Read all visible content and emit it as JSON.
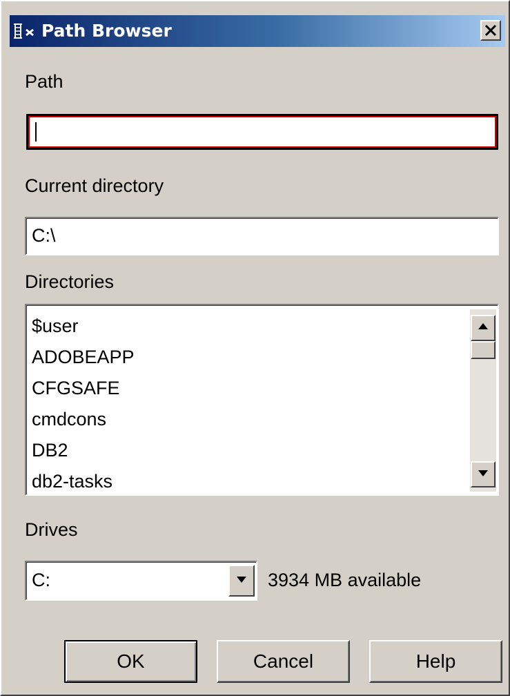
{
  "window": {
    "title": "Path Browser",
    "close_icon": "close-x-icon",
    "app_icon": "java-cup-icon",
    "titlebar_color_start": "#0a246a",
    "titlebar_color_end": "#a6caf0",
    "background_color": "#d4d0c8"
  },
  "path": {
    "label": "Path",
    "value": ""
  },
  "current_directory": {
    "label": "Current directory",
    "value": "C:\\"
  },
  "directories": {
    "label": "Directories",
    "items": [
      "$user",
      "ADOBEAPP",
      "CFGSAFE",
      "cmdcons",
      "DB2",
      "db2-tasks"
    ]
  },
  "drives": {
    "label": "Drives",
    "selected": "C:",
    "available": "3934 MB available"
  },
  "buttons": {
    "ok": "OK",
    "cancel": "Cancel",
    "help": "Help"
  }
}
